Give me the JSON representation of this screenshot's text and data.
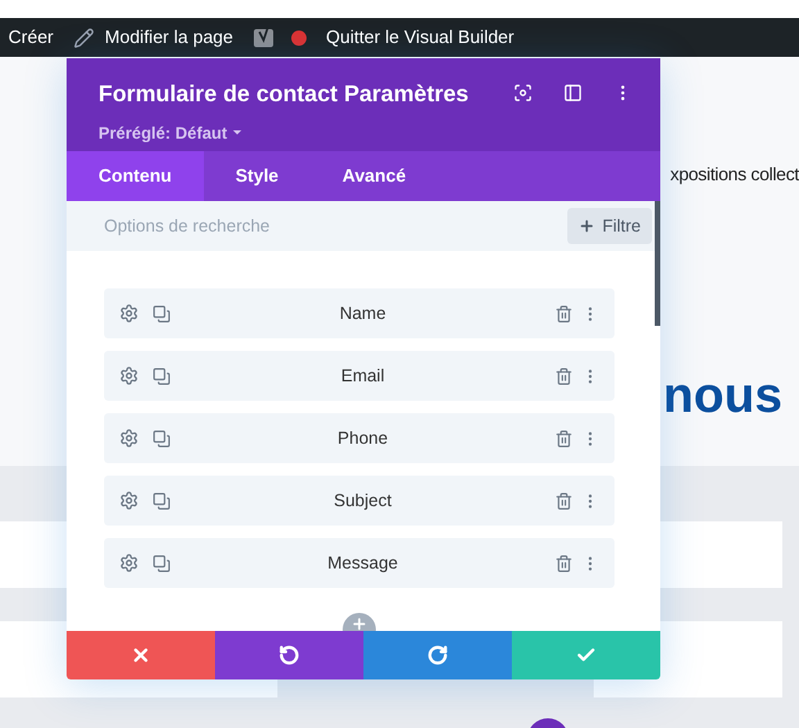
{
  "admin_bar": {
    "items": [
      {
        "kind": "create",
        "label": "Créer"
      },
      {
        "kind": "edit",
        "label": "Modifier la page"
      },
      {
        "kind": "seo"
      },
      {
        "kind": "exit",
        "label": "Quitter le Visual Builder"
      }
    ]
  },
  "page": {
    "snippet": "xpositions collect",
    "heading": "nous"
  },
  "modal": {
    "title": "Formulaire de contact Paramètres",
    "preset": "Préréglé: Défaut",
    "tabs": [
      {
        "label": "Contenu",
        "selected": true
      },
      {
        "label": "Style",
        "selected": false
      },
      {
        "label": "Avancé",
        "selected": false
      }
    ],
    "search": {
      "placeholder": "Options de recherche"
    },
    "filter_button": "Filtre",
    "fields": [
      {
        "label": "Name"
      },
      {
        "label": "Email"
      },
      {
        "label": "Phone"
      },
      {
        "label": "Subject"
      },
      {
        "label": "Message"
      }
    ],
    "footer": [
      {
        "kind": "cancel"
      },
      {
        "kind": "undo"
      },
      {
        "kind": "redo"
      },
      {
        "kind": "save"
      }
    ]
  }
}
